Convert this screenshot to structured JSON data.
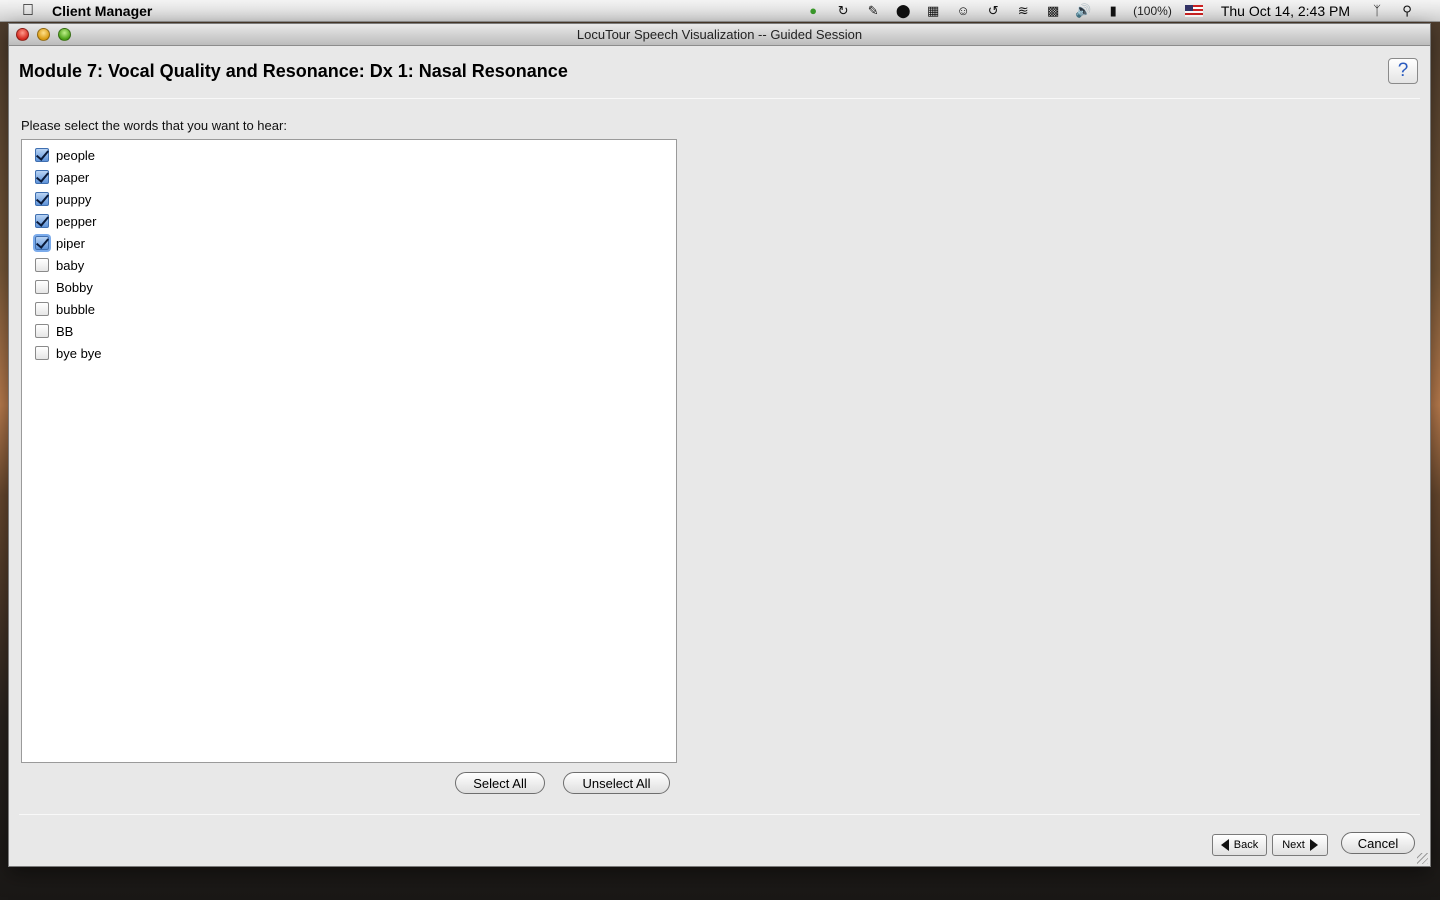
{
  "menubar": {
    "app_name": "Client Manager",
    "battery_text": "(100%)",
    "clock": "Thu Oct 14,  2:43 PM",
    "icons": [
      "apple-icon",
      "evernote-icon",
      "sync-icon",
      "script-icon",
      "status-icon",
      "grid-icon",
      "accessibility-icon",
      "time-machine-icon",
      "wifi-icon",
      "display-icon",
      "volume-icon",
      "battery-icon",
      "us-flag-icon",
      "bluetooth-icon",
      "spotlight-icon"
    ]
  },
  "window": {
    "title": "LocuTour Speech Visualization -- Guided Session",
    "module_title": "Module 7: Vocal Quality and Resonance: Dx 1: Nasal Resonance",
    "help_label": "?"
  },
  "prompt": "Please select the words that you want to hear:",
  "words": [
    {
      "label": "people",
      "checked": true
    },
    {
      "label": "paper",
      "checked": true
    },
    {
      "label": "puppy",
      "checked": true
    },
    {
      "label": "pepper",
      "checked": true
    },
    {
      "label": "piper",
      "checked": true
    },
    {
      "label": "baby",
      "checked": false
    },
    {
      "label": "Bobby",
      "checked": false
    },
    {
      "label": "bubble",
      "checked": false
    },
    {
      "label": "BB",
      "checked": false
    },
    {
      "label": "bye bye",
      "checked": false
    }
  ],
  "buttons": {
    "select_all": "Select All",
    "unselect_all": "Unselect All",
    "back": "Back",
    "next": "Next",
    "cancel": "Cancel"
  }
}
